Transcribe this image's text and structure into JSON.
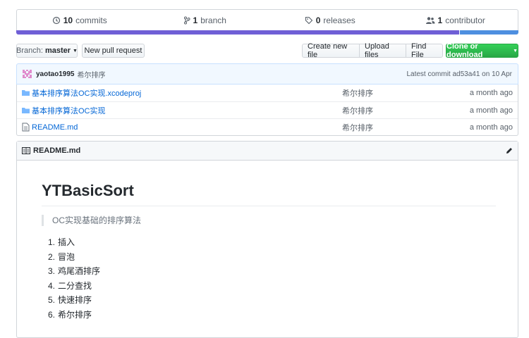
{
  "summary": {
    "commits": {
      "count": "10",
      "label": "commits"
    },
    "branches": {
      "count": "1",
      "label": "branch"
    },
    "releases": {
      "count": "0",
      "label": "releases"
    },
    "contributors": {
      "count": "1",
      "label": "contributor"
    }
  },
  "language_bar": {
    "colors": [
      "#6f5fd6",
      "#4e8fe0"
    ]
  },
  "toolbar": {
    "branch_prefix": "Branch:",
    "branch_name": "master",
    "new_pull_request": "New pull request",
    "create_new_file": "Create new file",
    "upload_files": "Upload files",
    "find_file": "Find File",
    "clone_or_download": "Clone or download"
  },
  "commit": {
    "author": "yaotao1995",
    "message": "希尔排序",
    "latest_label": "Latest commit ad53a41 on 10 Apr"
  },
  "files": [
    {
      "icon": "folder-icon",
      "name": "基本排序算法OC实现.xcodeproj",
      "message": "希尔排序",
      "age": "a month ago"
    },
    {
      "icon": "folder-icon",
      "name": "基本排序算法OC实现",
      "message": "希尔排序",
      "age": "a month ago"
    },
    {
      "icon": "file-icon",
      "name": "README.md",
      "message": "希尔排序",
      "age": "a month ago"
    }
  ],
  "readme": {
    "filename": "README.md",
    "title": "YTBasicSort",
    "quote": "OC实现基础的排序算法",
    "items": [
      "插入",
      "冒泡",
      "鸡尾酒排序",
      "二分查找",
      "快速排序",
      "希尔排序"
    ]
  }
}
